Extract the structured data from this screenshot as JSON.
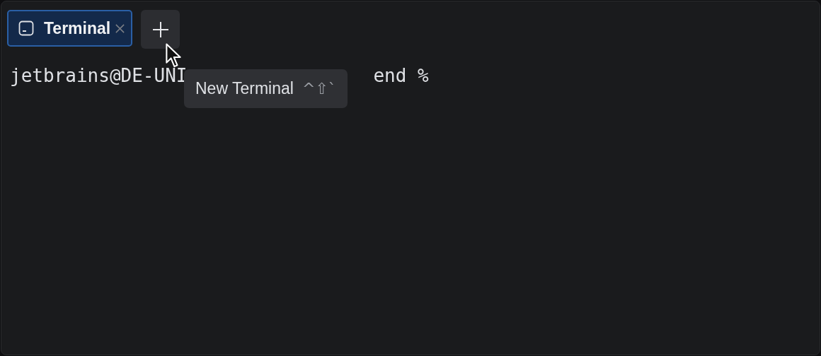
{
  "tabs": [
    {
      "label": "Terminal",
      "selected": true,
      "closable": true
    }
  ],
  "new_tab_button": {
    "hovered": true
  },
  "terminal": {
    "prompt_start": "jetbrains@DE-UNI",
    "prompt_end": "end %"
  },
  "tooltip": {
    "label": "New Terminal",
    "shortcut": "^⇧`"
  }
}
